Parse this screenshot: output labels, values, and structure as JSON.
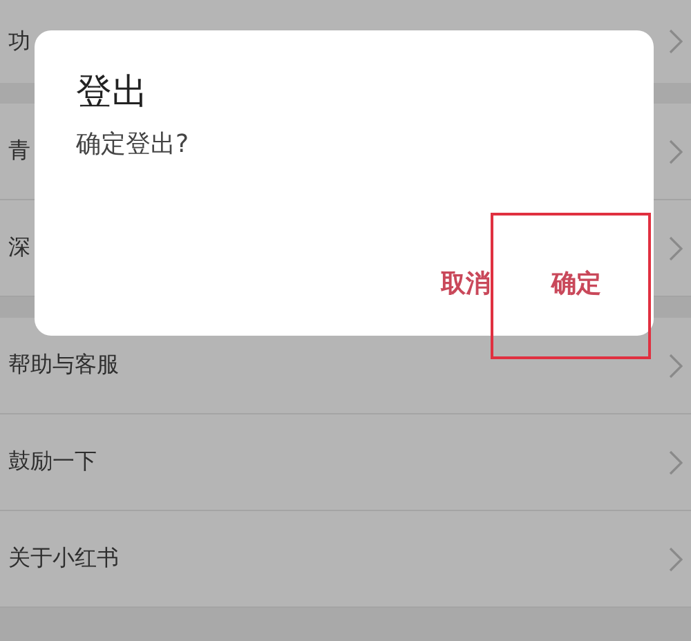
{
  "settings_sections": [
    {
      "items": [
        {
          "label": "功"
        }
      ]
    },
    {
      "items": [
        {
          "label": "青"
        },
        {
          "label": "深"
        }
      ]
    },
    {
      "items": [
        {
          "label": "帮助与客服"
        },
        {
          "label": "鼓励一下"
        },
        {
          "label": "关于小红书"
        }
      ]
    }
  ],
  "dialog": {
    "title": "登出",
    "message": "确定登出?",
    "buttons": [
      {
        "label": "取消",
        "highlighted": false
      },
      {
        "label": "确定",
        "highlighted": true
      }
    ]
  }
}
